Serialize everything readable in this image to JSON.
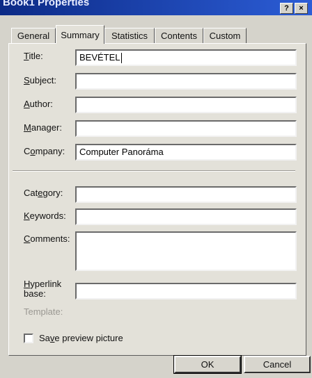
{
  "window": {
    "title": "Book1 Properties",
    "help_glyph": "?",
    "close_glyph": "×"
  },
  "tabs": [
    {
      "label": "General"
    },
    {
      "label": "Summary"
    },
    {
      "label": "Statistics"
    },
    {
      "label": "Contents"
    },
    {
      "label": "Custom"
    }
  ],
  "active_tab": "Summary",
  "fields": {
    "title": {
      "label_u": "T",
      "label_rest": "itle:",
      "value": "BEVÉTEL"
    },
    "subject": {
      "label_u": "S",
      "label_rest": "ubject:",
      "value": ""
    },
    "author": {
      "label_u": "A",
      "label_rest": "uthor:",
      "value": ""
    },
    "manager": {
      "label_u": "M",
      "label_rest": "anager:",
      "value": ""
    },
    "company": {
      "label_pre": "C",
      "label_u": "o",
      "label_rest": "mpany:",
      "value": "Computer Panoráma"
    },
    "category": {
      "label_pre": "Cat",
      "label_u": "e",
      "label_rest": "gory:",
      "value": ""
    },
    "keywords": {
      "label_u": "K",
      "label_rest": "eywords:",
      "value": ""
    },
    "comments": {
      "label_u": "C",
      "label_rest": "omments:",
      "value": ""
    },
    "hyperlink": {
      "label_u": "H",
      "label_rest": "yperlink",
      "label_line2": "base:",
      "value": ""
    },
    "template": {
      "label": "Template:"
    }
  },
  "checkbox": {
    "label_pre": "Sa",
    "label_u": "v",
    "label_rest": "e preview picture",
    "checked": false
  },
  "buttons": {
    "ok": "OK",
    "cancel": "Cancel"
  }
}
